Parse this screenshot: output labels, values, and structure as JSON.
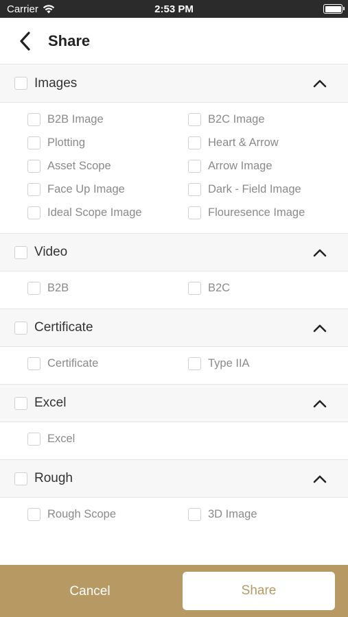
{
  "status_bar": {
    "carrier": "Carrier",
    "time": "2:53 PM"
  },
  "nav": {
    "title": "Share"
  },
  "sections": [
    {
      "title": "Images",
      "items": [
        "B2B Image",
        "B2C Image",
        "Plotting",
        "Heart & Arrow",
        "Asset Scope",
        "Arrow Image",
        "Face Up Image",
        "Dark - Field Image",
        "Ideal Scope Image",
        "Flouresence Image"
      ]
    },
    {
      "title": "Video",
      "items": [
        "B2B",
        "B2C"
      ]
    },
    {
      "title": "Certificate",
      "items": [
        "Certificate",
        "Type IIA"
      ]
    },
    {
      "title": "Excel",
      "items": [
        "Excel"
      ]
    },
    {
      "title": "Rough",
      "items": [
        "Rough Scope",
        "3D Image"
      ]
    }
  ],
  "footer": {
    "cancel_label": "Cancel",
    "share_label": "Share"
  },
  "colors": {
    "accent": "#b79963",
    "status_bar": "#2b2b2b"
  }
}
